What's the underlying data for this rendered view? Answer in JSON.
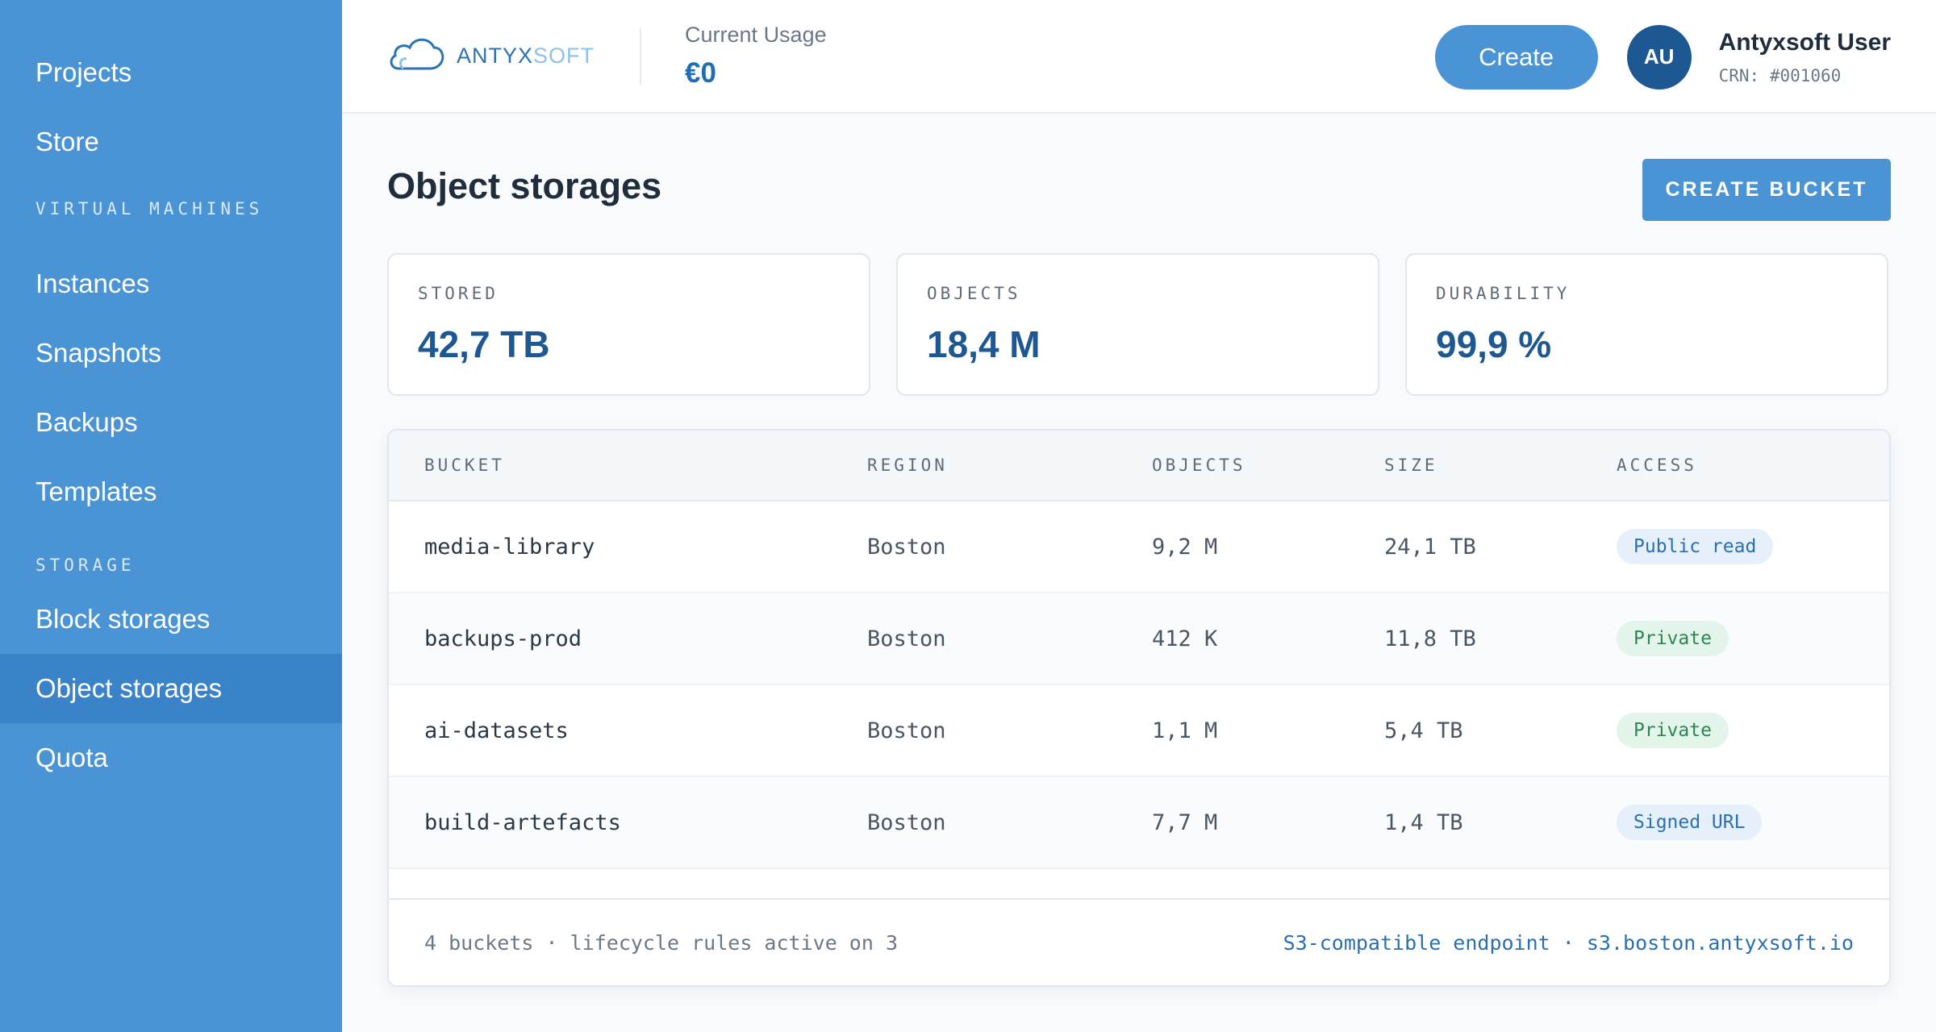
{
  "sidebar": {
    "items_top": [
      {
        "label": "Projects"
      },
      {
        "label": "Store"
      }
    ],
    "section_vm": "VIRTUAL MACHINES",
    "items_vm": [
      {
        "label": "Instances"
      },
      {
        "label": "Snapshots"
      },
      {
        "label": "Backups"
      },
      {
        "label": "Templates"
      }
    ],
    "section_storage": "STORAGE",
    "items_storage": [
      {
        "label": "Block storages"
      },
      {
        "label": "Object storages",
        "active": true
      },
      {
        "label": "Quota"
      }
    ]
  },
  "header": {
    "logo": {
      "part1": "ANTYX",
      "part2": "SOFT",
      "icon": "cloud-icon"
    },
    "usage_label": "Current Usage",
    "usage_value": "€0",
    "create_label": "Create",
    "avatar_initials": "AU",
    "user_name": "Antyxsoft User",
    "user_crn": "CRN: #001060"
  },
  "page": {
    "title": "Object storages",
    "create_bucket_label": "CREATE BUCKET"
  },
  "stats": [
    {
      "label": "STORED",
      "value": "42,7 TB"
    },
    {
      "label": "OBJECTS",
      "value": "18,4 M"
    },
    {
      "label": "DURABILITY",
      "value": "99,9 %"
    }
  ],
  "table": {
    "columns": [
      "BUCKET",
      "REGION",
      "OBJECTS",
      "SIZE",
      "ACCESS"
    ],
    "rows": [
      {
        "bucket": "media-library",
        "region": "Boston",
        "objects": "9,2 M",
        "size": "24,1 TB",
        "access": "Public read"
      },
      {
        "bucket": "backups-prod",
        "region": "Boston",
        "objects": "412 K",
        "size": "11,8 TB",
        "access": "Private"
      },
      {
        "bucket": "ai-datasets",
        "region": "Boston",
        "objects": "1,1 M",
        "size": "5,4 TB",
        "access": "Private"
      },
      {
        "bucket": "build-artefacts",
        "region": "Boston",
        "objects": "7,7 M",
        "size": "1,4 TB",
        "access": "Signed URL"
      }
    ],
    "footer_left": "4 buckets · lifecycle rules active on 3",
    "footer_right": "S3-compatible endpoint · s3.boston.antyxsoft.io"
  },
  "colors": {
    "sidebar": "#4a94d6",
    "sidebar_active": "#3b83c9",
    "accent": "#4a94d6",
    "value_blue": "#1e5893",
    "badge_private": "#2f8552",
    "badge_public": "#2a6fb2"
  }
}
